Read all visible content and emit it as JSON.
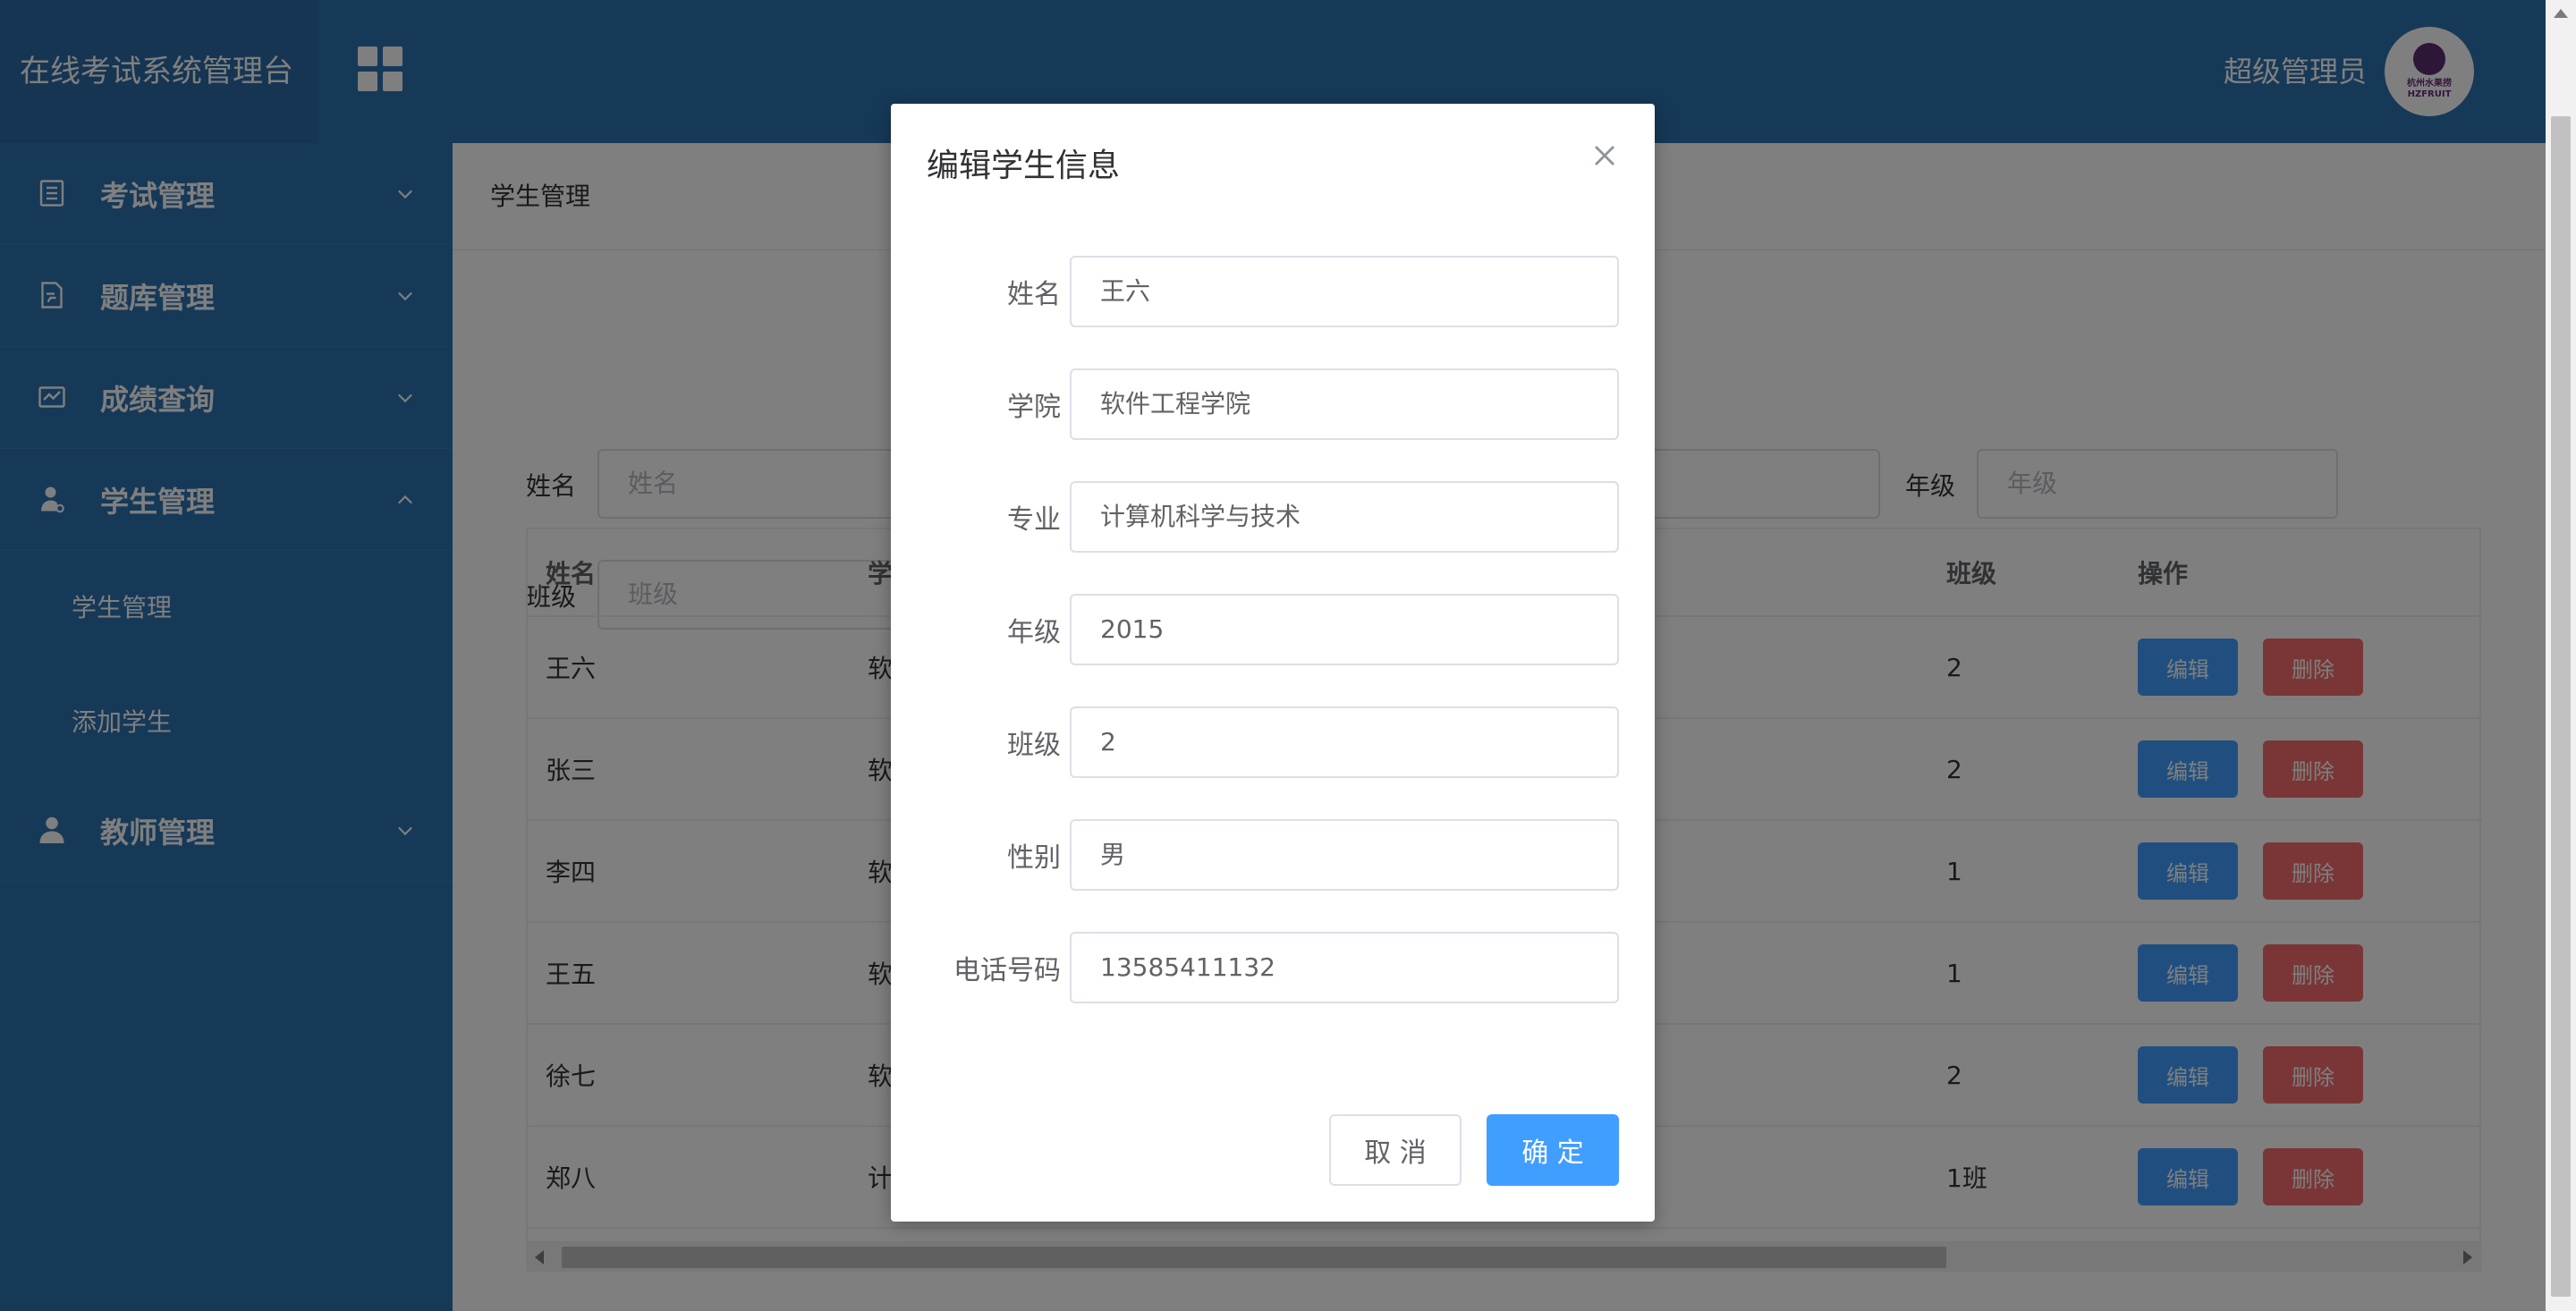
{
  "app": {
    "title": "在线考试系统管理台",
    "user_name": "超级管理员",
    "avatar_text": "杭州水果捞 HZFRUIT"
  },
  "sidebar": {
    "menus": [
      {
        "label": "考试管理",
        "icon": "exam-list-icon"
      },
      {
        "label": "题库管理",
        "icon": "question-bank-icon"
      },
      {
        "label": "成绩查询",
        "icon": "score-icon"
      },
      {
        "label": "学生管理",
        "icon": "student-icon"
      },
      {
        "label": "教师管理",
        "icon": "teacher-icon"
      }
    ],
    "sub_items": [
      "学生管理",
      "添加学生"
    ]
  },
  "main": {
    "breadcrumb": "学生管理",
    "filters": {
      "name_label": "姓名",
      "name_placeholder": "姓名",
      "grade_label": "年级",
      "grade_placeholder": "年级",
      "class_label": "班级",
      "class_placeholder": "班级"
    },
    "table": {
      "columns": [
        "姓名",
        "学",
        "班级",
        "操作"
      ],
      "rows": [
        {
          "name": "王六",
          "school": "软",
          "class": "2"
        },
        {
          "name": "张三",
          "school": "软",
          "class": "2"
        },
        {
          "name": "李四",
          "school": "软",
          "class": "1"
        },
        {
          "name": "王五",
          "school": "软",
          "class": "1"
        },
        {
          "name": "徐七",
          "school": "软",
          "class": "2"
        },
        {
          "name": "郑八",
          "school": "计",
          "class": "1班"
        }
      ],
      "edit_label": "编辑",
      "delete_label": "删除"
    }
  },
  "dialog": {
    "title": "编辑学生信息",
    "fields": [
      {
        "label": "姓名",
        "value": "王六"
      },
      {
        "label": "学院",
        "value": "软件工程学院"
      },
      {
        "label": "专业",
        "value": "计算机科学与技术"
      },
      {
        "label": "年级",
        "value": "2015"
      },
      {
        "label": "班级",
        "value": "2"
      },
      {
        "label": "性别",
        "value": "男"
      },
      {
        "label": "电话号码",
        "value": "13585411132"
      }
    ],
    "cancel_label": "取 消",
    "confirm_label": "确 定"
  },
  "colors": {
    "primary": "#409eff",
    "danger": "#f56c6c",
    "header": "#2c73b1"
  }
}
